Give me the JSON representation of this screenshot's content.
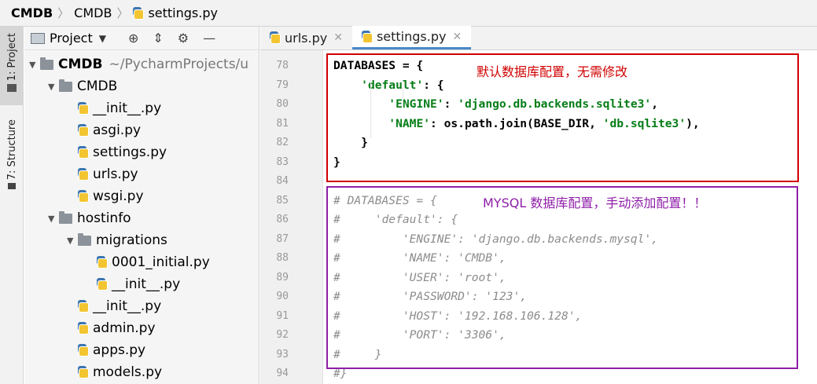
{
  "breadcrumb": {
    "root": "CMDB",
    "folder": "CMDB",
    "file": "settings.py",
    "separator": "〉"
  },
  "left_strip": {
    "project_tab": "1: Project",
    "structure_tab": "7: Structure"
  },
  "project_panel": {
    "title": "Project",
    "tree": [
      {
        "label": "CMDB",
        "suffix": "~/PycharmProjects/u",
        "type": "folder",
        "level": 0,
        "expanded": true,
        "bold": true
      },
      {
        "label": "CMDB",
        "type": "folder",
        "level": 1,
        "expanded": true
      },
      {
        "label": "__init__.py",
        "type": "file",
        "level": 2
      },
      {
        "label": "asgi.py",
        "type": "file",
        "level": 2
      },
      {
        "label": "settings.py",
        "type": "file",
        "level": 2
      },
      {
        "label": "urls.py",
        "type": "file",
        "level": 2
      },
      {
        "label": "wsgi.py",
        "type": "file",
        "level": 2
      },
      {
        "label": "hostinfo",
        "type": "folder",
        "level": 1,
        "expanded": true
      },
      {
        "label": "migrations",
        "type": "folder",
        "level": 2,
        "expanded": true
      },
      {
        "label": "0001_initial.py",
        "type": "file",
        "level": 3
      },
      {
        "label": "__init__.py",
        "type": "file",
        "level": 3
      },
      {
        "label": "__init__.py",
        "type": "file",
        "level": 2
      },
      {
        "label": "admin.py",
        "type": "file",
        "level": 2
      },
      {
        "label": "apps.py",
        "type": "file",
        "level": 2
      },
      {
        "label": "models.py",
        "type": "file",
        "level": 2
      }
    ]
  },
  "tabs": [
    {
      "label": "urls.py",
      "active": false
    },
    {
      "label": "settings.py",
      "active": true
    }
  ],
  "editor": {
    "lines": [
      {
        "n": "78",
        "fold": true,
        "parts": [
          [
            "b",
            "DATABASES = {"
          ]
        ]
      },
      {
        "n": "79",
        "fold": true,
        "parts": [
          [
            "b",
            "    "
          ],
          [
            "str",
            "'default'"
          ],
          [
            "b",
            ": {"
          ]
        ]
      },
      {
        "n": "80",
        "parts": [
          [
            "b",
            "        "
          ],
          [
            "str",
            "'ENGINE'"
          ],
          [
            "b",
            ": "
          ],
          [
            "str",
            "'django.db.backends.sqlite3'"
          ],
          [
            "b",
            ","
          ]
        ]
      },
      {
        "n": "81",
        "parts": [
          [
            "b",
            "        "
          ],
          [
            "str",
            "'NAME'"
          ],
          [
            "b",
            ": os.path.join(BASE_DIR, "
          ],
          [
            "str",
            "'db.sqlite3'"
          ],
          [
            "b",
            "),"
          ]
        ]
      },
      {
        "n": "82",
        "fold": true,
        "parts": [
          [
            "b",
            "    }"
          ]
        ]
      },
      {
        "n": "83",
        "fold": true,
        "parts": [
          [
            "b",
            "}"
          ]
        ]
      },
      {
        "n": "84",
        "parts": []
      },
      {
        "n": "85",
        "fold": true,
        "parts": [
          [
            "com",
            "# DATABASES = {"
          ]
        ]
      },
      {
        "n": "86",
        "parts": [
          [
            "com",
            "#     'default': {"
          ]
        ]
      },
      {
        "n": "87",
        "parts": [
          [
            "com",
            "#         'ENGINE': 'django.db.backends.mysql',"
          ]
        ]
      },
      {
        "n": "88",
        "parts": [
          [
            "com",
            "#         'NAME': 'CMDB',"
          ]
        ]
      },
      {
        "n": "89",
        "parts": [
          [
            "com",
            "#         'USER': 'root',"
          ]
        ]
      },
      {
        "n": "90",
        "parts": [
          [
            "com",
            "#         'PASSWORD': '123',"
          ]
        ]
      },
      {
        "n": "91",
        "parts": [
          [
            "com",
            "#         'HOST': '192.168.106.128',"
          ]
        ]
      },
      {
        "n": "92",
        "parts": [
          [
            "com",
            "#         'PORT': '3306',"
          ]
        ]
      },
      {
        "n": "93",
        "parts": [
          [
            "com",
            "#     }"
          ]
        ]
      },
      {
        "n": "94",
        "parts": [
          [
            "com",
            "#}"
          ]
        ]
      }
    ]
  },
  "annotations": {
    "red": "默认数据库配置，无需修改",
    "purple": "MYSQL 数据库配置，手动添加配置！！"
  },
  "colors": {
    "red_box": "#d00000",
    "purple_box": "#8e1ea8",
    "string": "#067d17",
    "comment": "#8c8c8c",
    "tab_accent": "#4a88c7"
  }
}
